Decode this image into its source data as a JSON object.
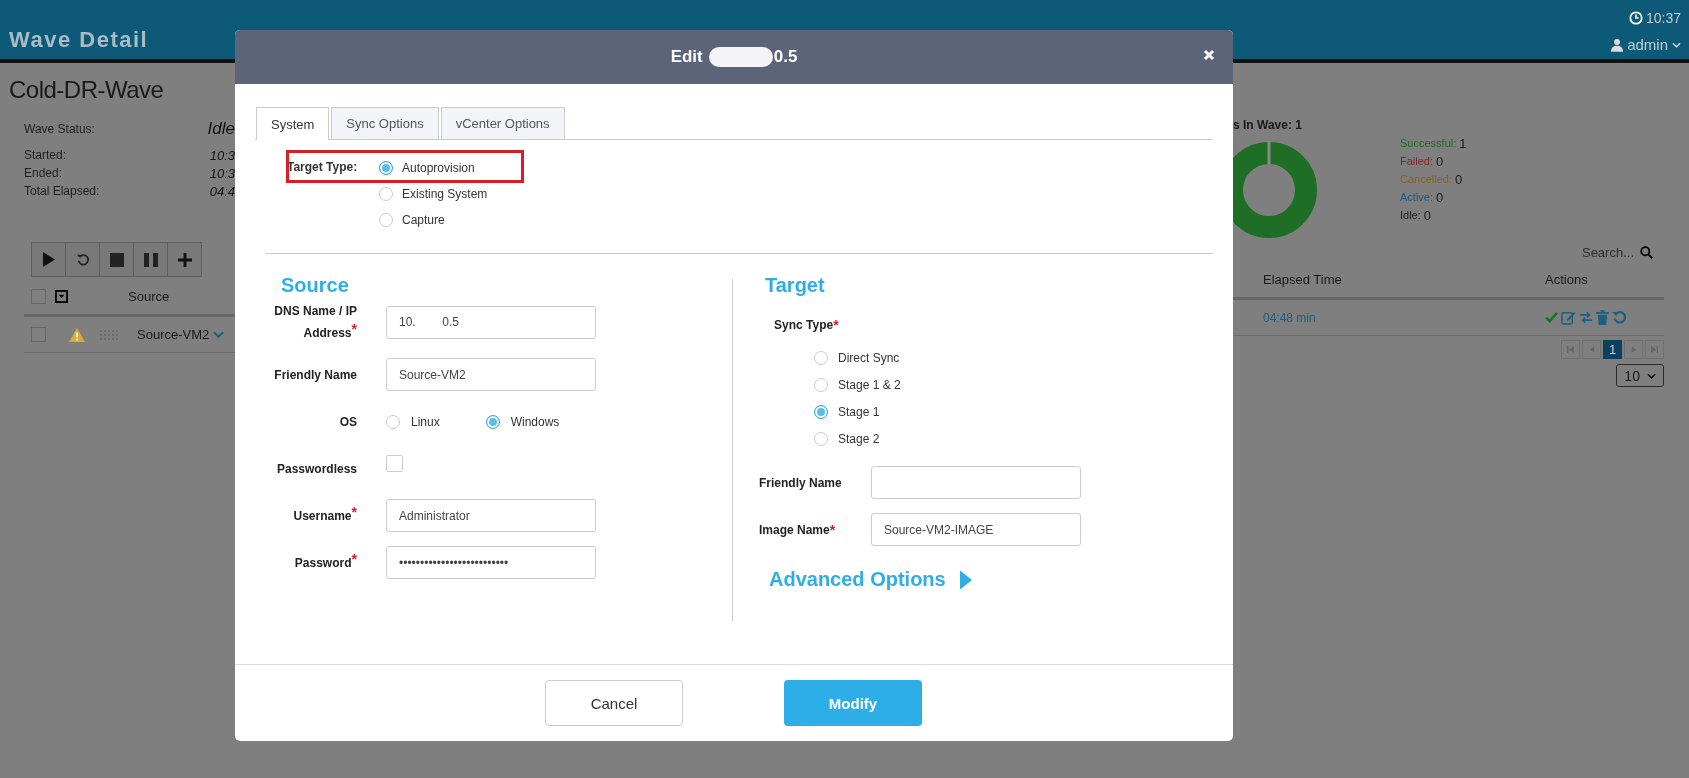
{
  "header": {
    "title": "Wave Detail",
    "clock": "10:37",
    "user": "admin"
  },
  "wave": {
    "name": "Cold-DR-Wave",
    "fields": [
      {
        "label": "Wave Status:",
        "value": "Idle",
        "kind": "status"
      },
      {
        "label": "Started:",
        "value": "10:3",
        "kind": "time"
      },
      {
        "label": "Ended:",
        "value": "10:3",
        "kind": "time"
      },
      {
        "label": "Total Elapsed:",
        "value": "04:4",
        "kind": "time"
      }
    ]
  },
  "table": {
    "header_checked": false,
    "columns": [
      "Source",
      "Elapsed Time",
      "Actions"
    ],
    "rows": [
      {
        "checked": false,
        "source": "Source-VM2",
        "elapsed": "04:48 min"
      }
    ]
  },
  "summary": {
    "count_label": "s In Wave: 1",
    "legend": [
      {
        "label": "Successful:",
        "value": "1",
        "color": "#1e6e25"
      },
      {
        "label": "Failed:",
        "value": "0",
        "color": "#8a2020"
      },
      {
        "label": "Cancelled:",
        "value": "0",
        "color": "#8a6218"
      },
      {
        "label": "Active:",
        "value": "0",
        "color": "#23557e"
      },
      {
        "label": "Idle:",
        "value": "0",
        "color": "#222222"
      }
    ]
  },
  "search": {
    "placeholder": "Search..."
  },
  "pagination": {
    "pages": [
      {
        "label": "1",
        "selected": true
      }
    ],
    "page_size": "10"
  },
  "modal": {
    "title_prefix": "Edit",
    "title_suffix": "0.5",
    "tabs": [
      {
        "label": "System",
        "selected": true
      },
      {
        "label": "Sync Options",
        "selected": false
      },
      {
        "label": "vCenter Options",
        "selected": false
      }
    ],
    "target_type": {
      "label": "Target Type:",
      "options": [
        {
          "label": "Autoprovision",
          "selected": true
        },
        {
          "label": "Existing System",
          "selected": false
        },
        {
          "label": "Capture",
          "selected": false
        }
      ]
    },
    "source": {
      "heading": "Source",
      "fields": [
        {
          "kind": "text",
          "label": "DNS Name / IP Address",
          "required_mark": "*",
          "value": "10.        0.5"
        },
        {
          "kind": "text",
          "label": "Friendly Name",
          "value": "Source-VM2"
        },
        {
          "kind": "radio",
          "label": "OS",
          "options": [
            {
              "label": "Linux",
              "selected": false
            },
            {
              "label": "Windows",
              "selected": true
            }
          ]
        },
        {
          "kind": "checkbox",
          "label": "Passwordless",
          "checked": false
        },
        {
          "kind": "text",
          "label": "Username",
          "required_mark": "*",
          "value": "Administrator"
        },
        {
          "kind": "text",
          "label": "Password",
          "required_mark": "*",
          "value": "••••••••••••••••••••••••••"
        }
      ]
    },
    "target": {
      "heading": "Target",
      "sync_label": "Sync Type",
      "sync_required_mark": "*",
      "sync_options": [
        {
          "label": "Direct Sync",
          "selected": false
        },
        {
          "label": "Stage 1 & 2",
          "selected": false
        },
        {
          "label": "Stage 1",
          "selected": true
        },
        {
          "label": "Stage 2",
          "selected": false
        }
      ],
      "fields": [
        {
          "label": "Friendly Name"
        },
        {
          "label": "Image Name",
          "required_mark": "*",
          "value": "Source-VM2-IMAGE"
        }
      ],
      "advanced": "Advanced Options"
    },
    "buttons": {
      "cancel": "Cancel",
      "modify": "Modify"
    }
  }
}
